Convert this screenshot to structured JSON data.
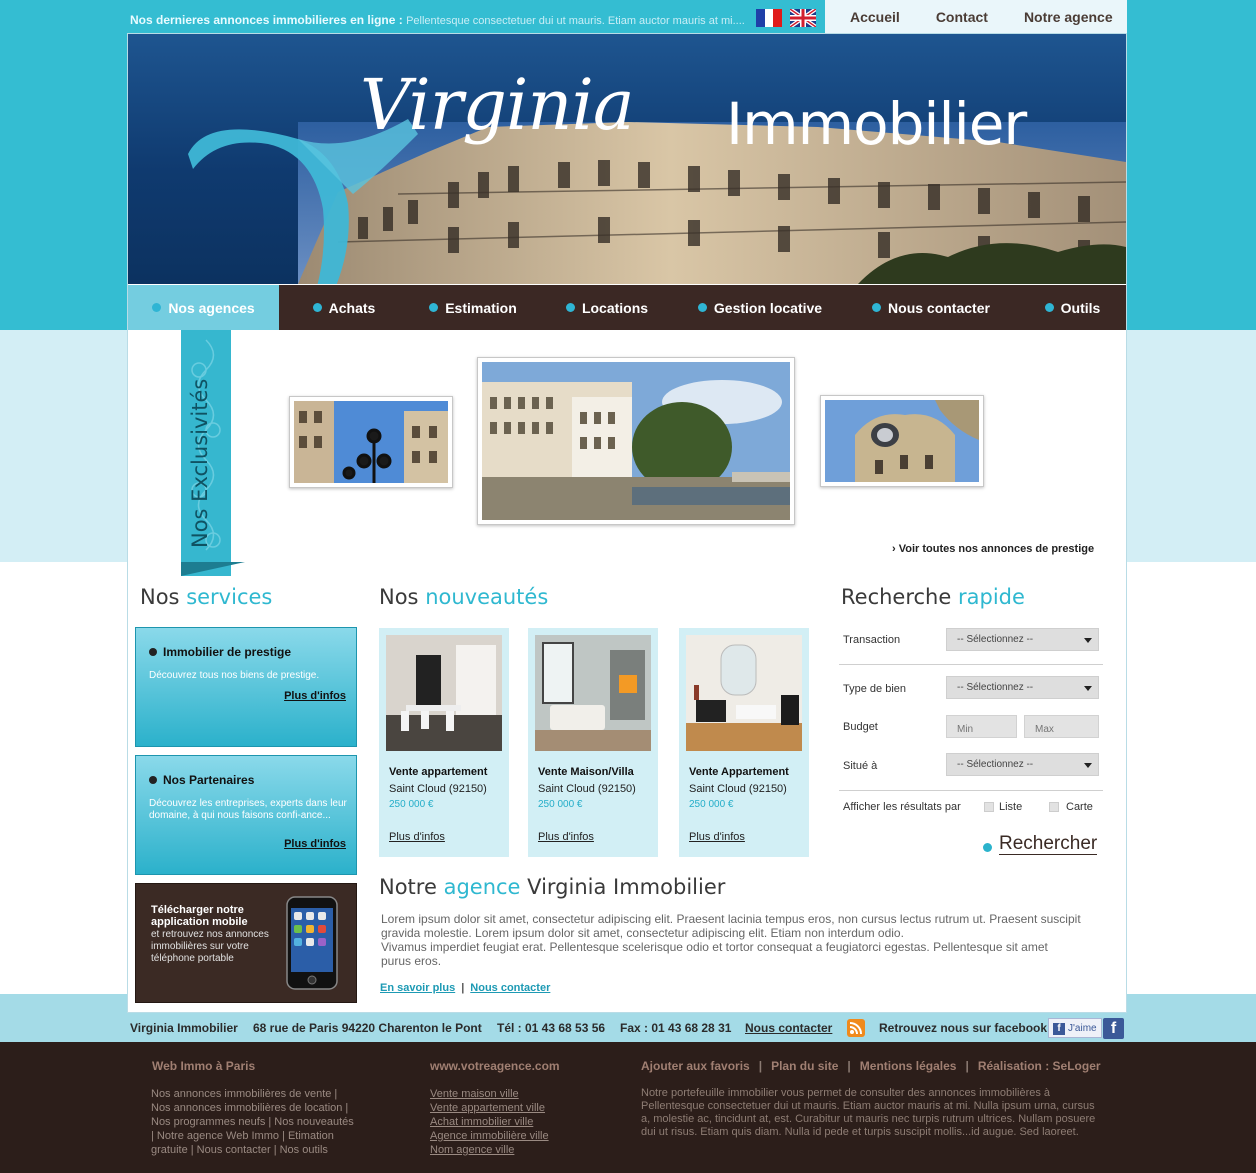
{
  "topbar": {
    "ticker_label": "Nos dernieres annonces immobilieres en ligne :",
    "ticker_text": "Pellentesque consectetuer dui ut mauris. Etiam auctor mauris at mi....",
    "nav": [
      "Accueil",
      "Contact",
      "Notre agence"
    ]
  },
  "brand": {
    "script": "Virginia",
    "plain": "Immobilier"
  },
  "mainnav": [
    {
      "label": "Nos agences",
      "active": true
    },
    {
      "label": "Achats",
      "active": false
    },
    {
      "label": "Estimation",
      "active": false
    },
    {
      "label": "Locations",
      "active": false
    },
    {
      "label": "Gestion locative",
      "active": false
    },
    {
      "label": "Nous contacter",
      "active": false
    },
    {
      "label": "Outils",
      "active": false
    }
  ],
  "exclusivites": {
    "ribbon_label": "Nos Exclusivités",
    "prestige_link": "› Voir toutes nos annonces de prestige"
  },
  "services": {
    "title_a": "Nos",
    "title_b": "services",
    "boxes": [
      {
        "title": "Immobilier de prestige",
        "desc": "Découvrez tous nos biens de prestige.",
        "more": "Plus d'infos"
      },
      {
        "title": "Nos Partenaires",
        "desc": "Découvrez les entreprises, experts dans leur domaine, à qui nous faisons confi-ance...",
        "more": "Plus d'infos"
      }
    ],
    "mobile": {
      "title": "Télécharger notre application mobile",
      "desc": "et retrouvez nos annonces immobilières sur votre téléphone portable"
    }
  },
  "nouveautes": {
    "title_a": "Nos",
    "title_b": "nouveautés",
    "cards": [
      {
        "title": "Vente appartement",
        "location": "Saint Cloud  (92150)",
        "price": "250 000 €",
        "more": "Plus d'infos"
      },
      {
        "title": "Vente Maison/Villa",
        "location": "Saint Cloud  (92150)",
        "price": "250 000 €",
        "more": "Plus d'infos"
      },
      {
        "title": "Vente Appartement",
        "location": "Saint Cloud  (92150)",
        "price": "250 000 €",
        "more": "Plus d'infos"
      }
    ]
  },
  "agence": {
    "title_a": "Notre",
    "title_b": "agence",
    "title_c": "Virginia Immobilier",
    "text1": "Lorem ipsum dolor sit amet, consectetur adipiscing elit. Praesent lacinia tempus eros, non cursus lectus rutrum ut. Praesent suscipit gravida molestie. Lorem ipsum dolor sit amet, consectetur adipiscing elit. Etiam non interdum odio.",
    "text2": "Vivamus imperdiet feugiat erat. Pellentesque scelerisque odio et tortor consequat a feugiatorci egestas. Pellentesque sit amet purus eros.",
    "link1": "En savoir plus",
    "link2": "Nous contacter"
  },
  "search": {
    "title_a": "Recherche",
    "title_b": "rapide",
    "transaction_label": "Transaction",
    "transaction_value": "-- Sélectionnez --",
    "type_label": "Type de bien",
    "type_value": "-- Sélectionnez --",
    "budget_label": "Budget",
    "min_placeholder": "Min",
    "max_placeholder": "Max",
    "situe_label": "Situé à",
    "situe_value": "-- Sélectionnez --",
    "display_label": "Afficher les résultats par",
    "opt_list": "Liste",
    "opt_map": "Carte",
    "button": "Rechercher"
  },
  "contact": {
    "company": "Virginia Immobilier",
    "address": "68 rue de Paris 94220 Charenton le Pont",
    "tel": "Tél : 01 43 68 53 56",
    "fax": "Fax : 01 43 68 28 31",
    "link": "Nous contacter",
    "facebook_text": "Retrouvez nous sur facebook",
    "like": "J'aime"
  },
  "footer": {
    "col1_title": "Web Immo à Paris",
    "col1_text": [
      "Nos annonces immobilières de vente |",
      "Nos annonces immobilières de location |",
      "Nos programmes neufs | Nos nouveautés",
      "| Notre agence Web Immo | Etimation",
      "gratuite | Nous contacter | Nos outils"
    ],
    "col2_title": "www.votreagence.com",
    "col2_links": [
      "Vente maison ville",
      "Vente appartement ville",
      "Achat immobilier ville",
      "Agence immobilière ville",
      "Nom agence ville"
    ],
    "col3_nav": [
      "Ajouter aux favoris",
      "Plan du site",
      "Mentions légales",
      "Réalisation : SeLoger"
    ],
    "col3_text": "Notre portefeuille immobilier vous permet de consulter des annonces immobilières à Pellentesque consectetuer dui ut mauris. Etiam auctor mauris at mi. Nulla ipsum urna, cursus a, molestie ac, tincidunt at, est. Curabitur ut mauris nec turpis rutrum ultrices. Nullam posuere dui ut risus. Etiam quis diam. Nulla id pede et turpis suscipit mollis...id augue. Sed laoreet."
  }
}
